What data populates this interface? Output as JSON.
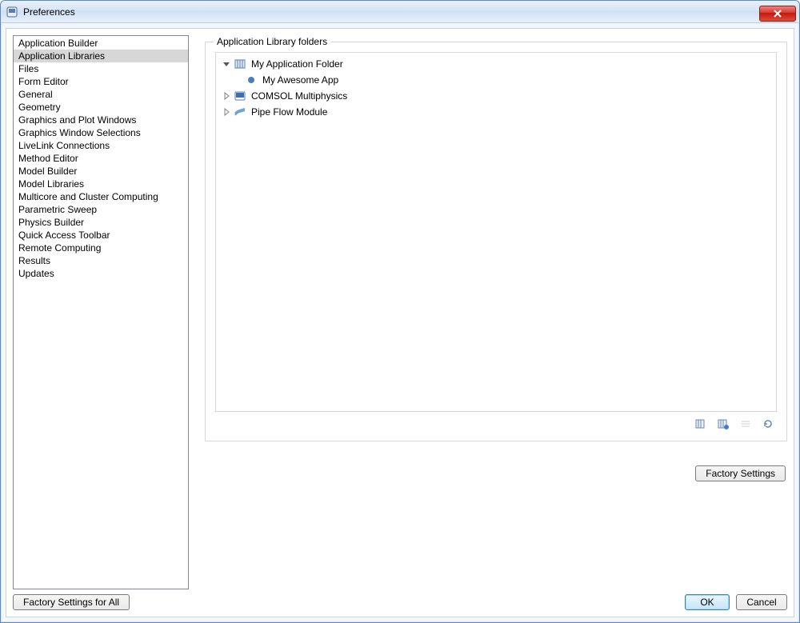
{
  "window": {
    "title": "Preferences"
  },
  "nav": {
    "items": [
      "Application Builder",
      "Application Libraries",
      "Files",
      "Form Editor",
      "General",
      "Geometry",
      "Graphics and Plot Windows",
      "Graphics Window Selections",
      "LiveLink Connections",
      "Method Editor",
      "Model Builder",
      "Model Libraries",
      "Multicore and Cluster Computing",
      "Parametric Sweep",
      "Physics Builder",
      "Quick Access Toolbar",
      "Remote Computing",
      "Results",
      "Updates"
    ],
    "selected_index": 1
  },
  "content": {
    "fieldset_label": "Application Library folders",
    "tree": {
      "root0": {
        "label": "My Application Folder",
        "child": "My Awesome App"
      },
      "root1": {
        "label": "COMSOL Multiphysics"
      },
      "root2": {
        "label": "Pipe Flow Module"
      }
    },
    "factory_settings_label": "Factory Settings"
  },
  "bottom": {
    "factory_all_label": "Factory Settings for All",
    "ok_label": "OK",
    "cancel_label": "Cancel"
  }
}
